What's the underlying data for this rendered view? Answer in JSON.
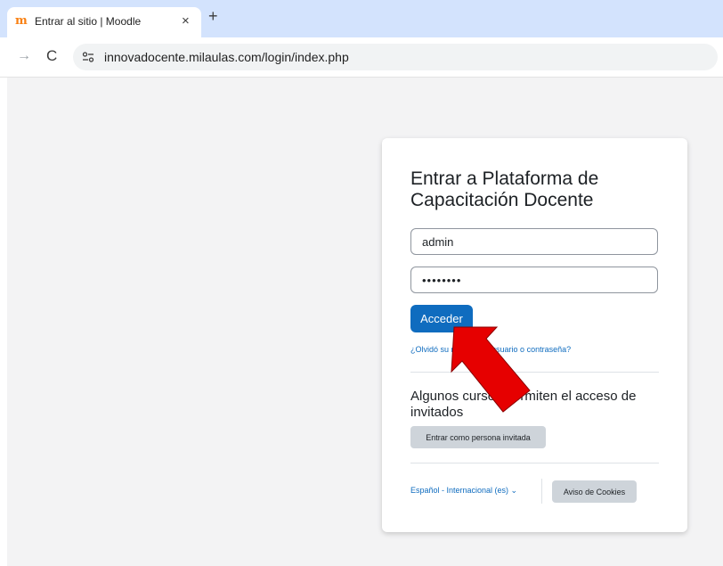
{
  "browser": {
    "tab": {
      "title": "Entrar al sitio | Moodle",
      "favicon": "moodle-logo-icon",
      "favicon_text": "m",
      "close": "×"
    },
    "new_tab": "+",
    "nav": {
      "forward": "→",
      "reload": "C"
    },
    "address_bar": {
      "url": "innovadocente.milaulas.com/login/index.php"
    }
  },
  "login": {
    "title": "Entrar a Plataforma de Capacitación Docente",
    "username_value": "admin",
    "password_value": "••••••••",
    "submit_label": "Acceder",
    "forgot_link": "¿Olvidó su nombre de usuario o contraseña?"
  },
  "guest": {
    "title": "Algunos cursos permiten el acceso de invitados",
    "button_label": "Entrar como persona invitada"
  },
  "footer": {
    "language": "Español - Internacional (es) ⌄",
    "cookies_label": "Aviso de Cookies"
  },
  "annotation": {
    "arrow_color": "#e60000"
  },
  "colors": {
    "primary": "#0f6cbf",
    "secondary_button": "#ced4da",
    "tabstrip": "#d3e3fd"
  }
}
